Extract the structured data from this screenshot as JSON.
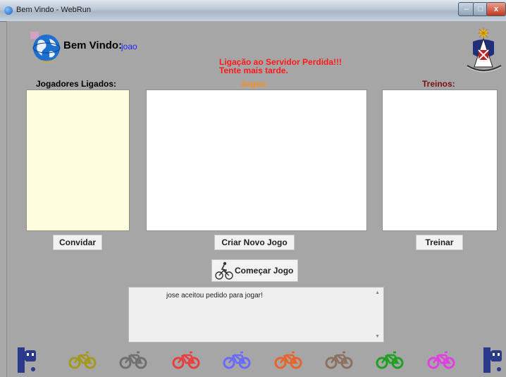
{
  "window": {
    "title": "Bem Vindo - WebRun"
  },
  "header": {
    "welcome_label": "Bem Vindo:",
    "username": "joao"
  },
  "error": {
    "line1": "Ligação ao Servidor Perdida!!!",
    "line2": "Tente mais tarde."
  },
  "columns": {
    "players_label": "Jogadores Ligados:",
    "games_label": "Jogos:",
    "trainings_label": "Treinos:"
  },
  "buttons": {
    "invite": "Convidar",
    "new_game": "Criar Novo Jogo",
    "train": "Treinar",
    "start_game": "Começar Jogo"
  },
  "log": {
    "message": "jose aceitou pedido para jogar!"
  },
  "colors": {
    "error": "#ff1a1a",
    "username": "#1e25ff",
    "games_label": "#ff8c1a",
    "trainings_label": "#7a1010",
    "players_panel": "#ffffe0"
  },
  "bikes": [
    "#a39a1c",
    "#707070",
    "#e74040",
    "#6a6aff",
    "#e8642a",
    "#8c7060",
    "#20a020",
    "#e040e0"
  ],
  "icons": [
    "globe-icon",
    "university-crest-icon",
    "cyclist-icon",
    "dubi-logo-icon",
    "bicycle-icon"
  ]
}
